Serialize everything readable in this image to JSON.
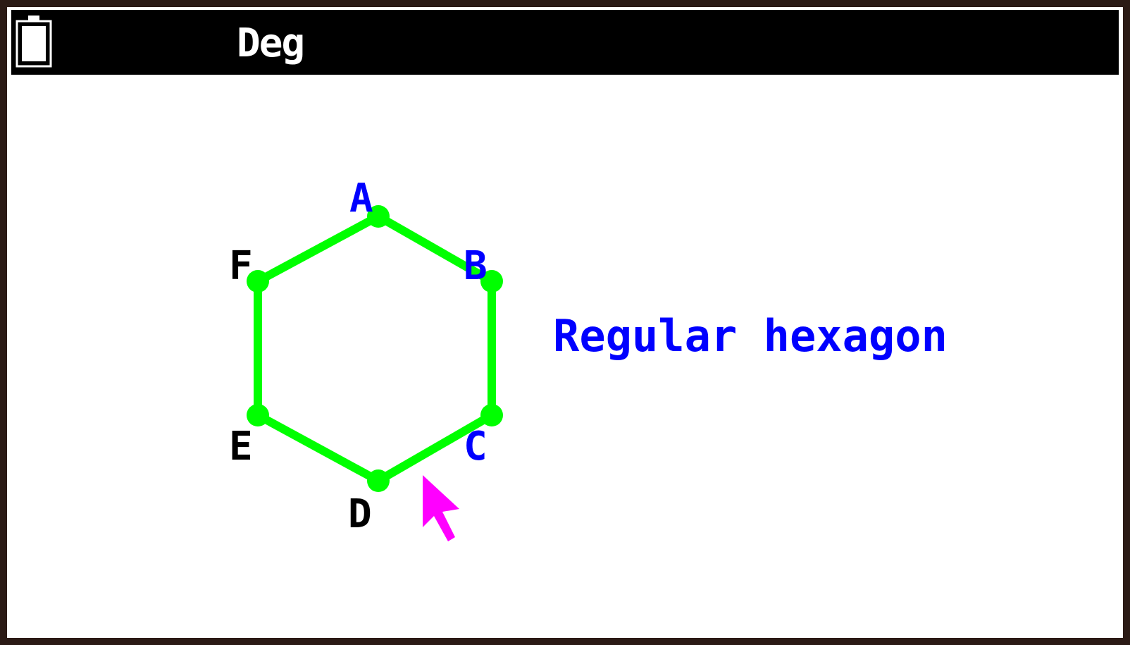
{
  "status_bar": {
    "angle_mode": "Deg",
    "battery_icon": "battery-icon"
  },
  "geometry": {
    "shape_label": "Regular hexagon",
    "vertices": [
      {
        "label": "A",
        "label_color": "#0000ff"
      },
      {
        "label": "B",
        "label_color": "#0000ff"
      },
      {
        "label": "C",
        "label_color": "#0000ff"
      },
      {
        "label": "D",
        "label_color": "#000000"
      },
      {
        "label": "E",
        "label_color": "#000000"
      },
      {
        "label": "F",
        "label_color": "#000000"
      }
    ],
    "edge_color": "#00ff00",
    "point_color": "#00ff00"
  },
  "cursor": {
    "icon": "pointer-arrow-icon",
    "color": "#ff00ff"
  },
  "colors": {
    "status_bar_bg": "#000000",
    "status_text": "#ffffff",
    "label_blue": "#0000ff",
    "screen_bg": "#ffffff",
    "bezel": "#2b1a15"
  }
}
